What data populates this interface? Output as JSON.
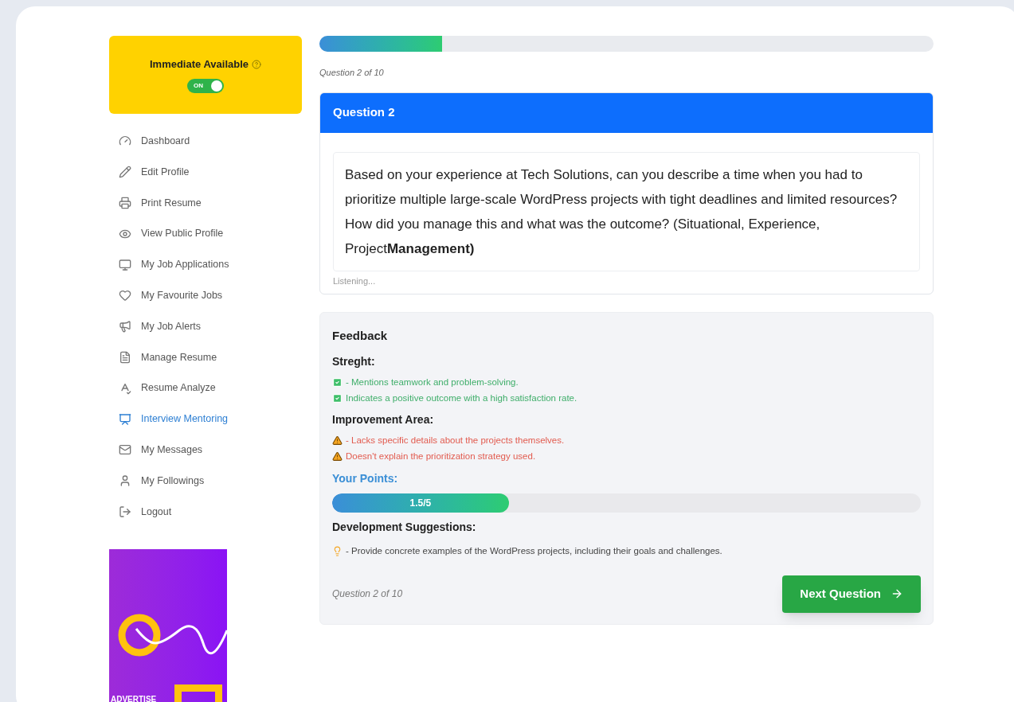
{
  "availability": {
    "title": "Immediate Available",
    "toggle": {
      "label": "ON",
      "on": true
    }
  },
  "sidebar": {
    "items": [
      {
        "label": "Dashboard",
        "selected": false
      },
      {
        "label": "Edit Profile",
        "selected": false
      },
      {
        "label": "Print Resume",
        "selected": false
      },
      {
        "label": "View Public Profile",
        "selected": false
      },
      {
        "label": "My Job Applications",
        "selected": false
      },
      {
        "label": "My Favourite Jobs",
        "selected": false
      },
      {
        "label": "My Job Alerts",
        "selected": false
      },
      {
        "label": "Manage Resume",
        "selected": false
      },
      {
        "label": "Resume Analyze",
        "selected": false
      },
      {
        "label": "Interview Mentoring",
        "selected": true
      },
      {
        "label": "My Messages",
        "selected": false
      },
      {
        "label": "My Followings",
        "selected": false
      },
      {
        "label": "Logout",
        "selected": false
      }
    ]
  },
  "ad": {
    "text": "ADVERTISE"
  },
  "progress": {
    "level": 0.2,
    "caption": "Question 2 of 10"
  },
  "question": {
    "title": "Question 2",
    "text": "Based on your experience at Tech Solutions, can you describe a time when you had to prioritize multiple large-scale WordPress projects with tight deadlines and limited resources? How did you manage this and what was the outcome? (Situational, Experience, Project**Management)**",
    "status": "Listening..."
  },
  "feedback": {
    "title": "Feedback",
    "sections": [
      {
        "kind": "strengths",
        "heading": "Streght:",
        "items": [
          "- Mentions teamwork and problem-solving.",
          "Indicates a positive outcome with a high satisfaction rate."
        ]
      },
      {
        "kind": "improvements",
        "heading": "Improvement Area:",
        "items": [
          "- Lacks specific details about the projects themselves.",
          "Doesn't explain the prioritization strategy used."
        ]
      },
      {
        "kind": "points",
        "heading": "Your Points:",
        "reading": "1.5/5",
        "level": 0.3
      },
      {
        "kind": "suggestions",
        "heading": "Development Suggestions:",
        "items": [
          "- Provide concrete examples of the WordPress projects, including their goals and challenges."
        ]
      }
    ],
    "caption": "Question 2 of 10",
    "next_button": "Next Question"
  }
}
